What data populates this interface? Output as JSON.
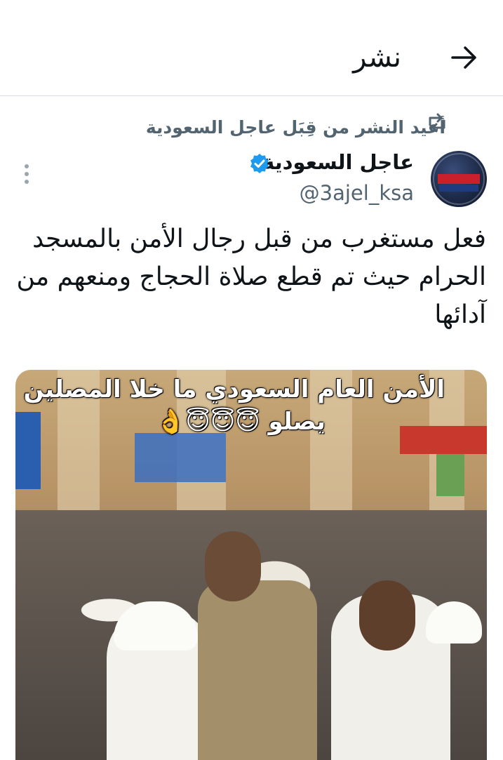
{
  "header": {
    "title": "نشر",
    "back_icon": "arrow-right-icon"
  },
  "retweet": {
    "text": "أعيد النشر من قِبَل عاجل السعودية",
    "icon": "retweet-icon"
  },
  "author": {
    "display_name": "عاجل السعودية",
    "handle": "@3ajel_ksa",
    "verified": true,
    "verified_color": "#1d9bf0"
  },
  "more_icon": "more-vertical-icon",
  "tweet": {
    "text": "فعل مستغرب من قبل رجال الأمن بالمسجد الحرام حيث تم قطع صلاة الحجاج ومنعهم من آدائها"
  },
  "media": {
    "overlay_line1": "الأمن العام السعودي ما خلا المصلين",
    "overlay_line2": "يصلو 😇😇😇👌"
  },
  "colors": {
    "text_primary": "#0f1419",
    "text_secondary": "#536471",
    "divider": "#d6dadf"
  }
}
